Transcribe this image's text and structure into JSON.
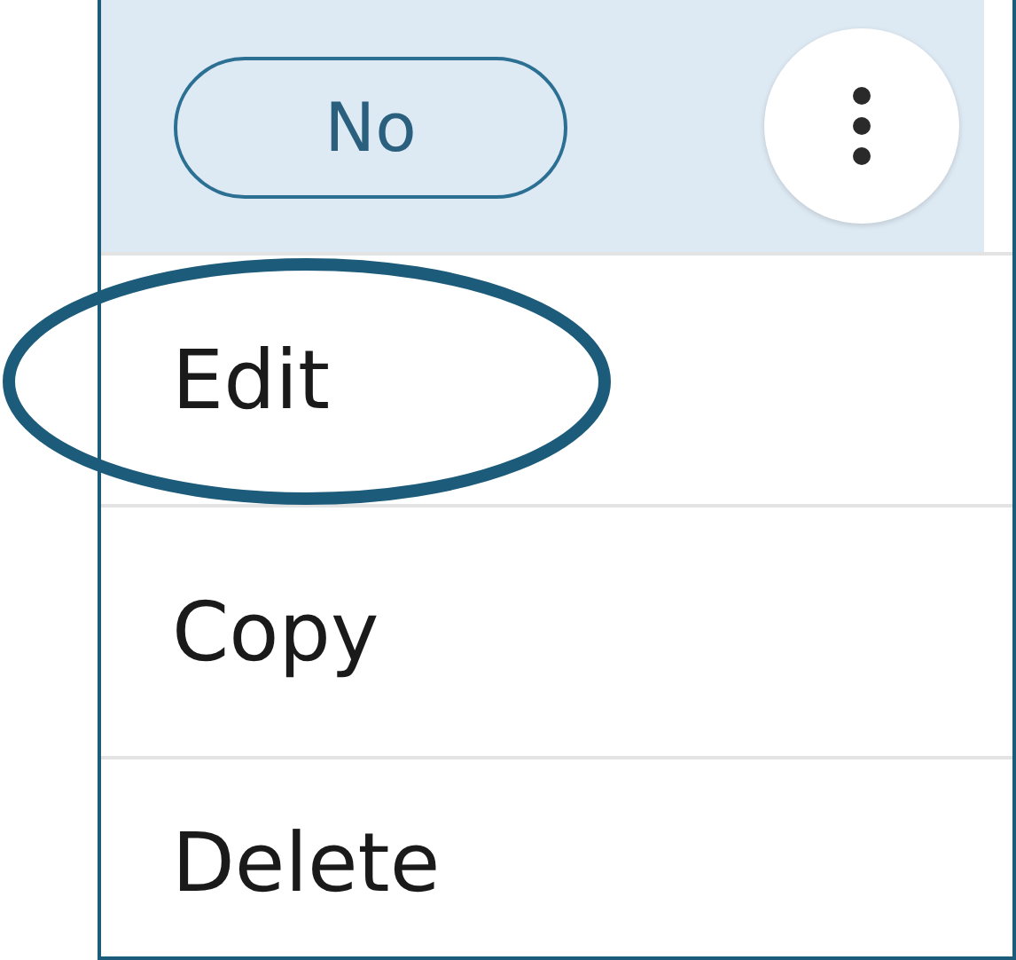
{
  "row": {
    "status": "No"
  },
  "menu": {
    "items": [
      {
        "label": "Edit",
        "circled": true
      },
      {
        "label": "Copy",
        "circled": false
      },
      {
        "label": "Delete",
        "circled": false
      }
    ]
  }
}
